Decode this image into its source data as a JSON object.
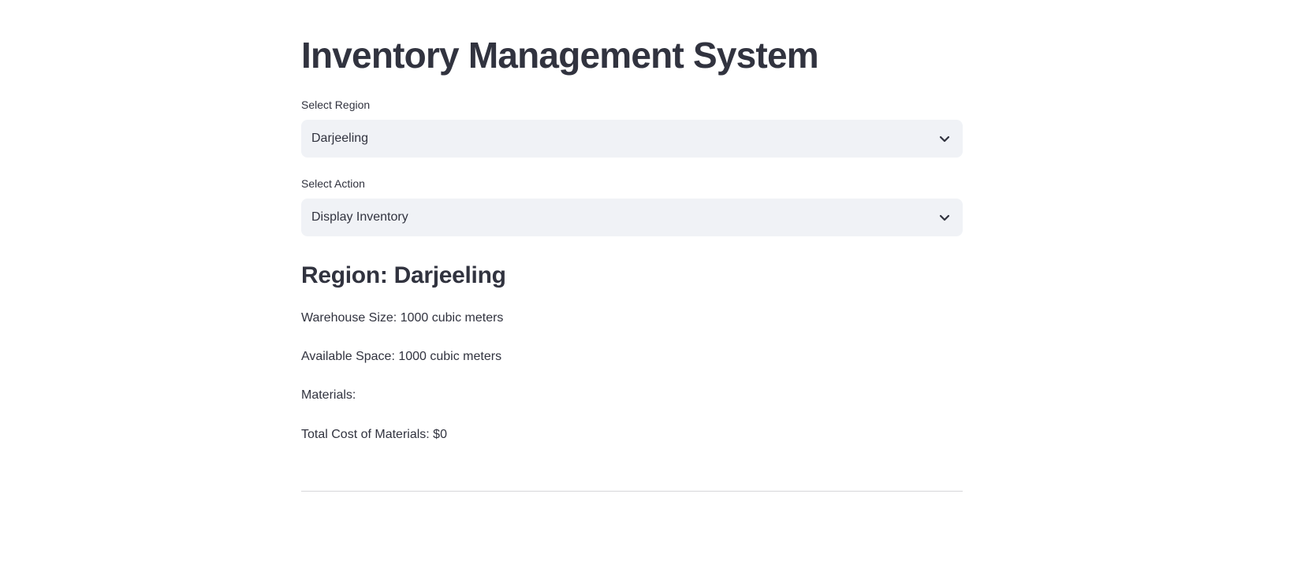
{
  "title": "Inventory Management System",
  "region_select": {
    "label": "Select Region",
    "value": "Darjeeling"
  },
  "action_select": {
    "label": "Select Action",
    "value": "Display Inventory"
  },
  "details": {
    "heading": "Region: Darjeeling",
    "warehouse_size": "Warehouse Size: 1000 cubic meters",
    "available_space": "Available Space: 1000 cubic meters",
    "materials": "Materials:",
    "total_cost": "Total Cost of Materials: $0"
  },
  "icons": {
    "dropdown": "chevron-down-icon"
  }
}
